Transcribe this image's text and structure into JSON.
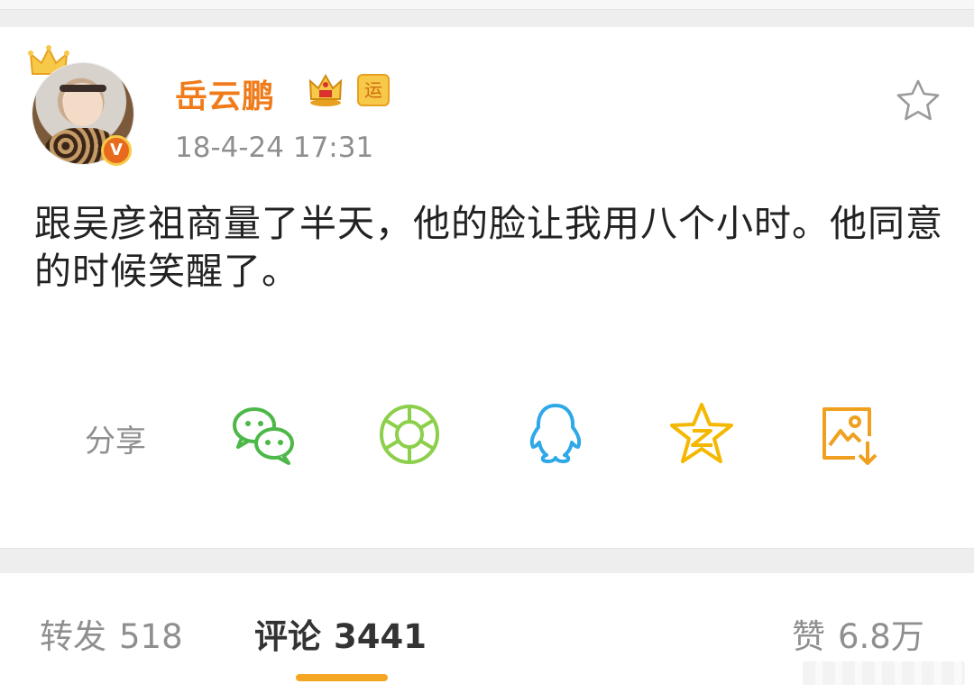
{
  "post": {
    "username": "岳云鹏",
    "badge_text": "运",
    "verified_mark": "V",
    "timestamp": "18-4-24 17:31",
    "text": "跟吴彦祖商量了半天，他的脸让我用八个小时。他同意的时候笑醒了。"
  },
  "share": {
    "label": "分享",
    "buttons": [
      {
        "icon": "wechat-icon",
        "color": "#4cb848"
      },
      {
        "icon": "moments-icon",
        "color": "#8ccf4a"
      },
      {
        "icon": "qq-icon",
        "color": "#2fa8e8"
      },
      {
        "icon": "qzone-icon",
        "color": "#f5b800"
      },
      {
        "icon": "save-image-icon",
        "color": "#f0a020"
      }
    ]
  },
  "tabs": {
    "repost": {
      "label": "转发",
      "count": "518"
    },
    "comment": {
      "label": "评论",
      "count": "3441"
    },
    "like": {
      "label": "赞",
      "count": "6.8万"
    }
  },
  "colors": {
    "accent_orange": "#f07b1a",
    "tab_indicator": "#f5a623",
    "muted_text": "#8f8f8f"
  }
}
